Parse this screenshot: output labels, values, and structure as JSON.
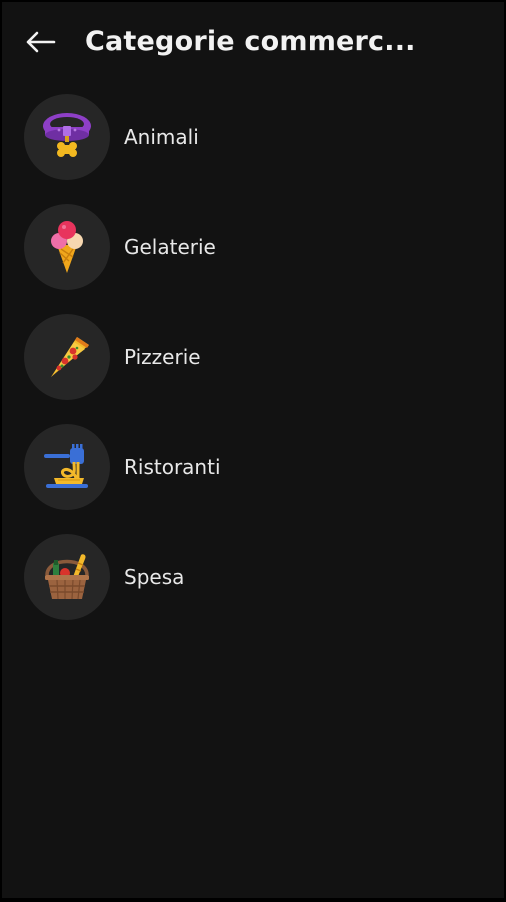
{
  "header": {
    "title": "Categorie commerc...",
    "back_icon": "arrow-left-icon"
  },
  "categories": [
    {
      "label": "Animali",
      "icon": "pet-collar-icon"
    },
    {
      "label": "Gelaterie",
      "icon": "ice-cream-cone-icon"
    },
    {
      "label": "Pizzerie",
      "icon": "pizza-slice-icon"
    },
    {
      "label": "Ristoranti",
      "icon": "pasta-fork-icon"
    },
    {
      "label": "Spesa",
      "icon": "grocery-basket-icon"
    }
  ],
  "colors": {
    "background": "#121212",
    "icon_circle": "#262626",
    "text": "#e8e8e8"
  }
}
